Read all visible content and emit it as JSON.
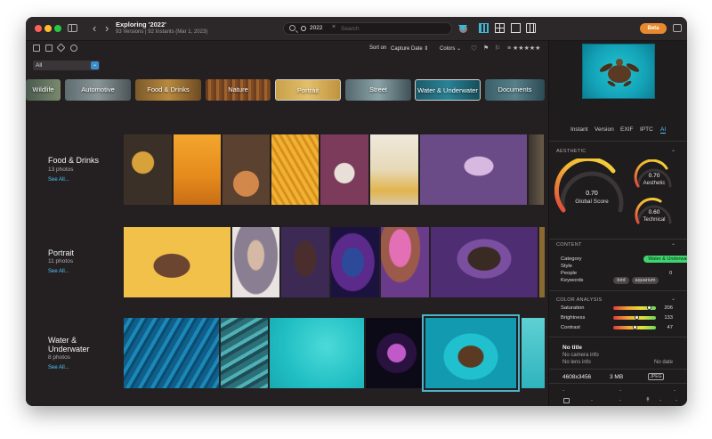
{
  "window": {
    "title": "Exploring '2022'",
    "subtitle": "93 Versions | 92 Instants (Mar 1, 2023)",
    "search_token": "2022",
    "search_placeholder": "Search",
    "beta_label": "Beta"
  },
  "toolbar": {
    "sort_label": "Sort on",
    "sort_value": "Capture Date ⇕",
    "colors_label": "Colors ⌄",
    "stars": "≡ ★★★★★"
  },
  "filter": {
    "value": "All"
  },
  "categories": [
    {
      "label": "Wildlife",
      "selected": false
    },
    {
      "label": "Automotive",
      "selected": false
    },
    {
      "label": "Food & Drinks",
      "selected": false
    },
    {
      "label": "Nature",
      "selected": false
    },
    {
      "label": "Portrait",
      "selected": true
    },
    {
      "label": "Street",
      "selected": false
    },
    {
      "label": "Water & Underwater",
      "selected": true
    },
    {
      "label": "Documents",
      "selected": false
    }
  ],
  "groups": [
    {
      "title": "Food & Drinks",
      "count": "13 photos",
      "link": "See All..."
    },
    {
      "title": "Portrait",
      "count": "11 photos",
      "link": "See All..."
    },
    {
      "title": "Water &\nUnderwater",
      "count": "8 photos",
      "link": "See All..."
    }
  ],
  "panel": {
    "tabs": [
      "Instant",
      "Version",
      "EXIF",
      "IPTC",
      "AI"
    ],
    "active_tab": "AI",
    "aesthetic_header": "AESTHETIC",
    "global_score": "0.70",
    "global_label": "Global Score",
    "aesthetic_score": "0.70",
    "aesthetic_label": "Aesthetic",
    "technical_score": "0.60",
    "technical_label": "Technical",
    "content_header": "CONTENT",
    "category_label": "Category",
    "category_value": "Water & Underwater",
    "style_label": "Style",
    "people_label": "People",
    "people_value": "0",
    "keywords_label": "Keywords",
    "keywords": [
      "bird",
      "aquarium"
    ],
    "color_header": "COLOR ANALYSIS",
    "saturation_label": "Saturation",
    "saturation_value": "206",
    "brightness_label": "Brightness",
    "brightness_value": "133",
    "contrast_label": "Contrast",
    "contrast_value": "47",
    "no_title": "No title",
    "no_camera": "No camera info",
    "no_lens": "No lens info",
    "no_date": "No date",
    "dimensions": "4608x3456",
    "filesize": "3 MB",
    "format": "JPEG",
    "dash": "-"
  },
  "colors": {
    "accent": "#4fc3f7",
    "beta": "#e9892d",
    "green": "#3ed46e"
  }
}
